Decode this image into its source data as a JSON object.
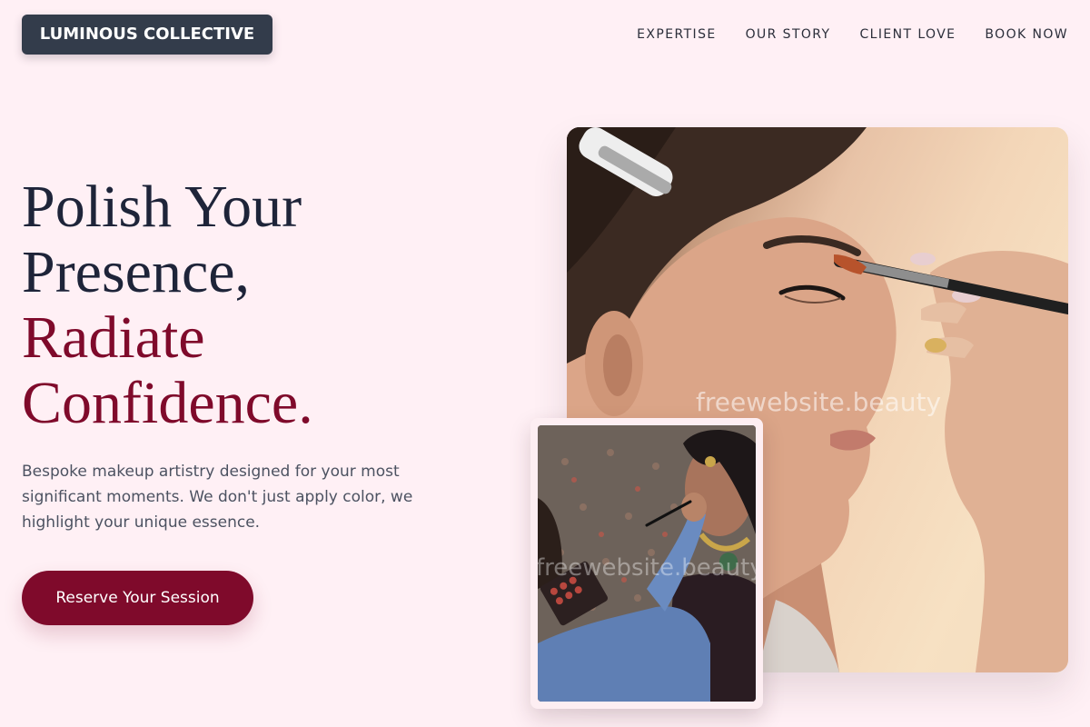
{
  "brand": {
    "logo_text": "LUMINOUS COLLECTIVE"
  },
  "nav": {
    "items": [
      {
        "label": "EXPERTISE"
      },
      {
        "label": "OUR STORY"
      },
      {
        "label": "CLIENT LOVE"
      },
      {
        "label": "BOOK NOW"
      }
    ]
  },
  "hero": {
    "headline_line1": "Polish Your",
    "headline_line2": "Presence,",
    "headline_line3": "Radiate",
    "headline_line4": "Confidence.",
    "lead": "Bespoke makeup artistry designed for your most significant moments. We don't just apply color, we highlight your unique essence.",
    "cta_label": "Reserve Your Session"
  },
  "images": {
    "main_watermark": "freewebsite.beauty",
    "secondary_watermark": "freewebsite.beauty"
  },
  "colors": {
    "background": "#fff0f5",
    "logo_bg": "#333c4b",
    "headline_dark": "#1e2439",
    "accent": "#7f0a2b",
    "body_text": "#4c5261"
  }
}
